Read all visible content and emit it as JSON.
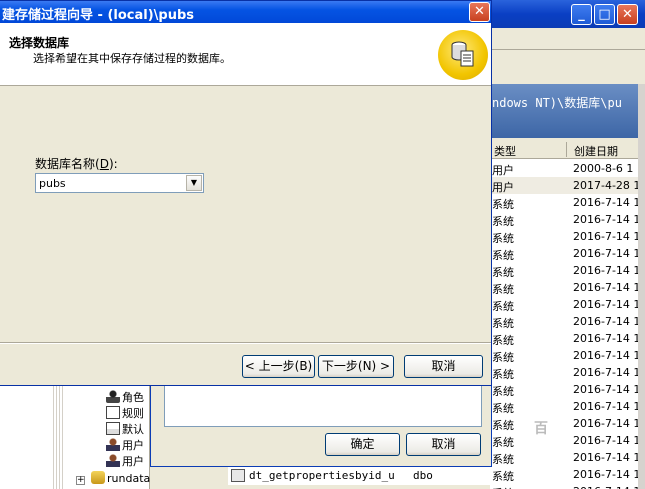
{
  "wizard": {
    "title": "建存储过程向导 - (local)\\pubs",
    "close_glyph": "✕",
    "header_title": "选择数据库",
    "header_subtitle": "选择希望在其中保存存储过程的数据库。",
    "field_label_prefix": "数据库名称(",
    "field_label_accel": "D",
    "field_label_suffix": "):",
    "database_value": "pubs",
    "back_label": "< 上一步(B)",
    "next_label": "下一步(N) >",
    "cancel_label": "取消"
  },
  "main_window": {
    "min_glyph": "_",
    "max_glyph": "□",
    "close_glyph": "✕",
    "path_text": "ndows NT)\\数据库\\pu"
  },
  "list": {
    "col_type": "类型",
    "col_date": "创建日期",
    "rows": [
      {
        "type": "用户",
        "date": "2000-8-6 1"
      },
      {
        "type": "用户",
        "date": "2017-4-28 1"
      },
      {
        "type": "系统",
        "date": "2016-7-14 1"
      },
      {
        "type": "系统",
        "date": "2016-7-14 1"
      },
      {
        "type": "系统",
        "date": "2016-7-14 1"
      },
      {
        "type": "系统",
        "date": "2016-7-14 1"
      },
      {
        "type": "系统",
        "date": "2016-7-14 1"
      },
      {
        "type": "系统",
        "date": "2016-7-14 1"
      },
      {
        "type": "系统",
        "date": "2016-7-14 1"
      },
      {
        "type": "系统",
        "date": "2016-7-14 1"
      },
      {
        "type": "系统",
        "date": "2016-7-14 1"
      },
      {
        "type": "系统",
        "date": "2016-7-14 1"
      },
      {
        "type": "系统",
        "date": "2016-7-14 1"
      },
      {
        "type": "系统",
        "date": "2016-7-14 1"
      },
      {
        "type": "系统",
        "date": "2016-7-14 1"
      },
      {
        "type": "系统",
        "date": "2016-7-14 1"
      },
      {
        "type": "系统",
        "date": "2016-7-14 1"
      },
      {
        "type": "系统",
        "date": "2016-7-14 1"
      },
      {
        "type": "系统",
        "date": "2016-7-14 1"
      },
      {
        "type": "系统",
        "date": "2016-7-14 1"
      }
    ]
  },
  "tree": {
    "items": [
      "角色",
      "规则",
      "默认",
      "用户",
      "用户"
    ],
    "rundata": "rundata",
    "expand_glyph": "+"
  },
  "inner_dialog": {
    "ok_label": "确定",
    "cancel_label": "取消"
  },
  "proc_row": {
    "name": "dt_getpropertiesbyid_u",
    "owner": "dbo"
  },
  "watermark": "百"
}
